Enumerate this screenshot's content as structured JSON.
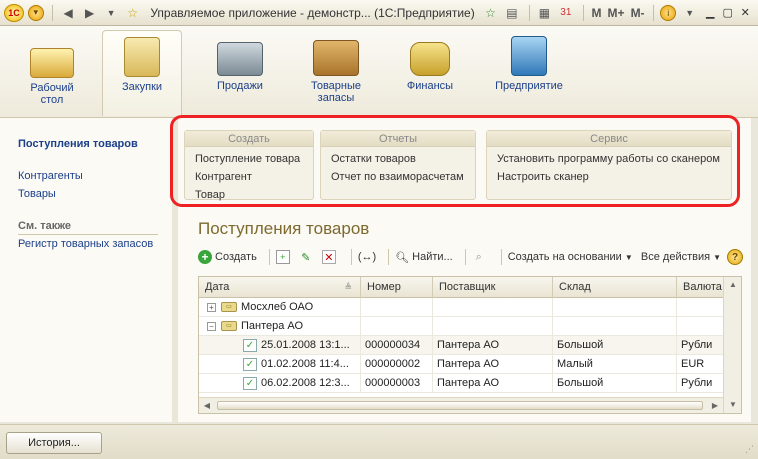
{
  "window": {
    "title": "Управляемое приложение - демонстр...  (1С:Предприятие)",
    "m_buttons": [
      "M",
      "M+",
      "M-"
    ]
  },
  "sections": [
    {
      "label": "Рабочий стол",
      "icon": "desk-icon",
      "active": false
    },
    {
      "label": "Закупки",
      "icon": "shopping-bag-icon",
      "active": true
    },
    {
      "label": "Продажи",
      "icon": "cash-register-icon",
      "active": false
    },
    {
      "label": "Товарные запасы",
      "icon": "box-icon",
      "active": false
    },
    {
      "label": "Финансы",
      "icon": "coins-icon",
      "active": false
    },
    {
      "label": "Предприятие",
      "icon": "building-icon",
      "active": false
    }
  ],
  "left_panel": {
    "current": "Поступления товаров",
    "items": [
      "Контрагенты",
      "Товары"
    ],
    "see_also_header": "См. также",
    "see_also_items": [
      "Регистр товарных запасов"
    ]
  },
  "action_panel": {
    "groups": [
      {
        "header": "Создать",
        "items": [
          "Поступление товара",
          "Контрагент",
          "Товар"
        ]
      },
      {
        "header": "Отчеты",
        "items": [
          "Остатки товаров",
          "Отчет по взаиморасчетам"
        ]
      },
      {
        "header": "Сервис",
        "items": [
          "Установить программу работы со сканером",
          "Настроить сканер"
        ]
      }
    ]
  },
  "form": {
    "title": "Поступления товаров",
    "toolbar": {
      "create": "Создать",
      "find": "Найти...",
      "create_based_on": "Создать на основании",
      "all_actions": "Все действия",
      "output_list": "(↔)"
    },
    "columns": [
      "Дата",
      "Номер",
      "Поставщик",
      "Склад",
      "Валюта"
    ],
    "rows": [
      {
        "type": "group",
        "expander": "+",
        "cells": [
          "Мосхлеб ОАО",
          "",
          "",
          "",
          ""
        ]
      },
      {
        "type": "group",
        "expander": "−",
        "cells": [
          "Пантера АО",
          "",
          "",
          "",
          ""
        ]
      },
      {
        "type": "doc",
        "cells": [
          "25.01.2008 13:1...",
          "000000034",
          "Пантера АО",
          "Большой",
          "Рубли"
        ]
      },
      {
        "type": "doc",
        "cells": [
          "01.02.2008 11:4...",
          "000000002",
          "Пантера АО",
          "Малый",
          "EUR"
        ]
      },
      {
        "type": "doc",
        "cells": [
          "06.02.2008 12:3...",
          "000000003",
          "Пантера АО",
          "Большой",
          "Рубли"
        ]
      }
    ]
  },
  "status_bar": {
    "history": "История..."
  }
}
